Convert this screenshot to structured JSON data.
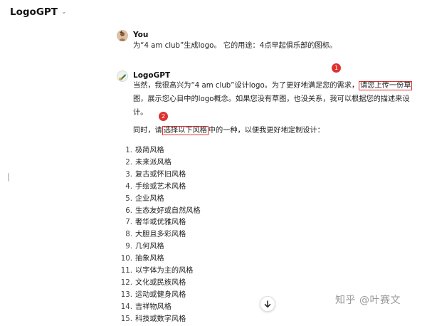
{
  "header": {
    "model_name": "LogoGPT",
    "chevron": "⌄"
  },
  "user_message": {
    "author": "You",
    "text": "为“4 am club”生成logo。 它的用途：4点早起俱乐部的图标。"
  },
  "bot_message": {
    "author": "LogoGPT",
    "line1_pre": "当然，我很高兴为“4 am club”设计logo。为了更好地满足您的需求，",
    "line1_highlight": "请您上传一份草",
    "line2": "图，展示您心目中的logo概念。如果您没有草图，也没关系，我可以根据您的描述来设",
    "line3": "计。",
    "p2_pre": "同时，请",
    "p2_highlight": "选择以下风格",
    "p2_post": "中的一种，以便我更好地定制设计：",
    "styles": [
      {
        "num": "1.",
        "label": "极简风格"
      },
      {
        "num": "2.",
        "label": "未来派风格"
      },
      {
        "num": "3.",
        "label": "复古或怀旧风格"
      },
      {
        "num": "4.",
        "label": "手绘或艺术风格"
      },
      {
        "num": "5.",
        "label": "企业风格"
      },
      {
        "num": "6.",
        "label": "生态友好或自然风格"
      },
      {
        "num": "7.",
        "label": "奢华或优雅风格"
      },
      {
        "num": "8.",
        "label": "大胆且多彩风格"
      },
      {
        "num": "9.",
        "label": "几何风格"
      },
      {
        "num": "10.",
        "label": "抽象风格"
      },
      {
        "num": "11.",
        "label": "以字体为主的风格"
      },
      {
        "num": "12.",
        "label": "文化或民族风格"
      },
      {
        "num": "13.",
        "label": "运动或健身风格"
      },
      {
        "num": "14.",
        "label": "吉祥物风格"
      },
      {
        "num": "15.",
        "label": "科技或数字风格"
      }
    ]
  },
  "annotations": {
    "badge1": "1",
    "badge2": "2",
    "color": "#e03131"
  },
  "scroll_button": {
    "icon": "arrow-down-icon"
  },
  "watermark": "知乎 @叶赛文"
}
